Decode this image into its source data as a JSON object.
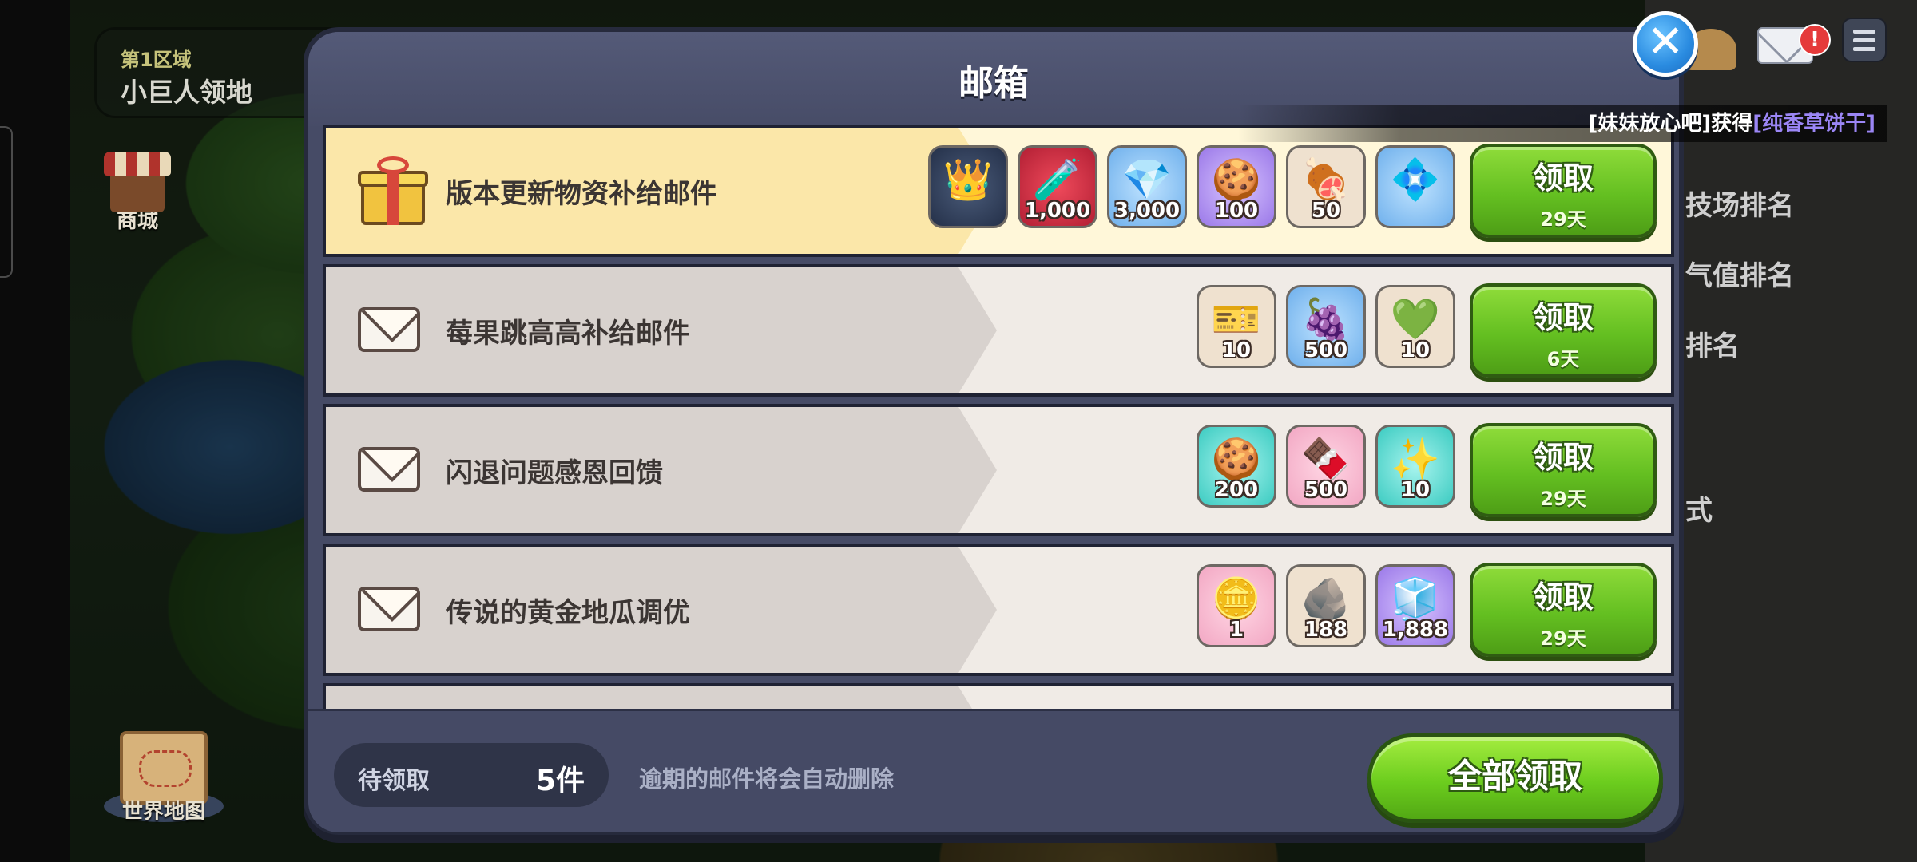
{
  "background": {
    "zone_number": "第1区域",
    "zone_name": "小巨人领地",
    "shop_label": "商城",
    "world_map_label": "世界地图",
    "mail_badge": "!",
    "side_menu": [
      "技场排名",
      "气值排名",
      "排名",
      "式"
    ],
    "notice": {
      "prefix": "[妹妹放心吧]获得",
      "item": "[纯香草饼干]",
      "item_color": "#9b86f5"
    }
  },
  "modal": {
    "title": "邮箱",
    "close_icon": "close-x-icon",
    "claim_label": "领取",
    "mails": [
      {
        "icon": "gift-icon",
        "title": "版本更新物资补给邮件",
        "featured": true,
        "days": "29天",
        "rewards": [
          {
            "icon": "costume-box-icon",
            "glyph": "👑",
            "bg": "bg-dark",
            "qty": ""
          },
          {
            "icon": "potion-icon",
            "glyph": "🧪",
            "bg": "bg-red",
            "qty": "1,000"
          },
          {
            "icon": "crystal-icon",
            "glyph": "💎",
            "bg": "bg-blue",
            "qty": "3,000"
          },
          {
            "icon": "cookie-cutter-icon",
            "glyph": "🍪",
            "bg": "bg-purple",
            "qty": "100"
          },
          {
            "icon": "meat-icon",
            "glyph": "🍖",
            "bg": "bg-cream",
            "qty": "50"
          },
          {
            "icon": "partial-item-icon",
            "glyph": "💠",
            "bg": "bg-blue",
            "qty": ""
          }
        ]
      },
      {
        "icon": "envelope-icon",
        "title": "莓果跳高高补给邮件",
        "featured": false,
        "days": "6天",
        "rewards": [
          {
            "icon": "ticket-icon",
            "glyph": "🎫",
            "bg": "bg-cream",
            "qty": "10"
          },
          {
            "icon": "blueberry-icon",
            "glyph": "🍇",
            "bg": "bg-blue",
            "qty": "500"
          },
          {
            "icon": "green-gem-icon",
            "glyph": "💚",
            "bg": "bg-cream",
            "qty": "10"
          }
        ]
      },
      {
        "icon": "envelope-icon",
        "title": "闪退问题感恩回馈",
        "featured": false,
        "days": "29天",
        "rewards": [
          {
            "icon": "cookie-cutter-icon",
            "glyph": "🍪",
            "bg": "bg-teal",
            "qty": "200"
          },
          {
            "icon": "brown-cookie-icon",
            "glyph": "🍫",
            "bg": "bg-pink",
            "qty": "500"
          },
          {
            "icon": "magic-shard-icon",
            "glyph": "✨",
            "bg": "bg-teal",
            "qty": "10"
          }
        ]
      },
      {
        "icon": "envelope-icon",
        "title": "传说的黄金地瓜调优",
        "featured": false,
        "days": "29天",
        "rewards": [
          {
            "icon": "gold-coin-icon",
            "glyph": "🪙",
            "bg": "bg-pink",
            "qty": "1"
          },
          {
            "icon": "ore-icon",
            "glyph": "🪨",
            "bg": "bg-cream",
            "qty": "188"
          },
          {
            "icon": "rainbow-cube-icon",
            "glyph": "🧊",
            "bg": "bg-purple",
            "qty": "1,888"
          }
        ]
      }
    ],
    "footer": {
      "pending_label": "待领取",
      "pending_count": "5件",
      "expire_note": "逾期的邮件将会自动删除",
      "claim_all": "全部领取"
    }
  }
}
